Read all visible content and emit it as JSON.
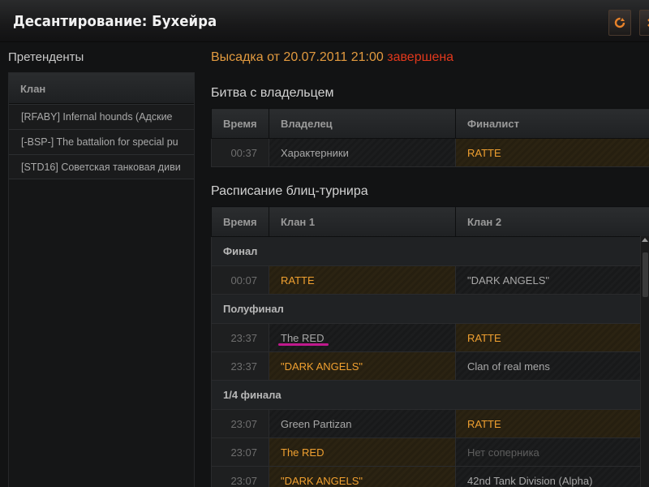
{
  "window": {
    "title": "Десантирование: Бухейра",
    "refresh_icon": "refresh-icon",
    "close_icon": "close-icon"
  },
  "left": {
    "heading": "Претенденты",
    "column": "Клан",
    "clans": [
      "[RFABY] Infernal hounds (Адские",
      "[-BSP-] The battalion for special pu",
      "[STD16] Советская танковая диви"
    ]
  },
  "landing": {
    "prefix": "Высадка от 20.07.2011 21:00",
    "status": "завершена"
  },
  "owner_battle": {
    "title": "Битва с владельцем",
    "headers": [
      "Время",
      "Владелец",
      "Финалист"
    ],
    "row": {
      "time": "00:37",
      "owner": "Характерники",
      "finalist": "RATTE"
    }
  },
  "tournament": {
    "title": "Расписание блиц-турнира",
    "headers": [
      "Время",
      "Клан 1",
      "Клан 2"
    ],
    "final": {
      "label": "Финал",
      "rows": [
        {
          "time": "00:07",
          "clan1": "RATTE",
          "clan2": "\"DARK ANGELS\""
        }
      ]
    },
    "semifinal": {
      "label": "Полуфинал",
      "rows": [
        {
          "time": "23:37",
          "clan1": "The RED",
          "clan2": "RATTE"
        },
        {
          "time": "23:37",
          "clan1": "\"DARK ANGELS\"",
          "clan2": "Clan of real mens"
        }
      ]
    },
    "quarterfinal": {
      "label": "1/4 финала",
      "rows": [
        {
          "time": "23:07",
          "clan1": "Green Partizan",
          "clan2": "RATTE"
        },
        {
          "time": "23:07",
          "clan1": "The RED",
          "clan2": "Нет соперника"
        },
        {
          "time": "23:07",
          "clan1": "\"DARK ANGELS\"",
          "clan2": "42nd Tank Division (Alpha)"
        }
      ]
    }
  },
  "colors": {
    "winner": "#f0a030",
    "landing_status": "#e2381c",
    "annotation": "#c0198d"
  }
}
